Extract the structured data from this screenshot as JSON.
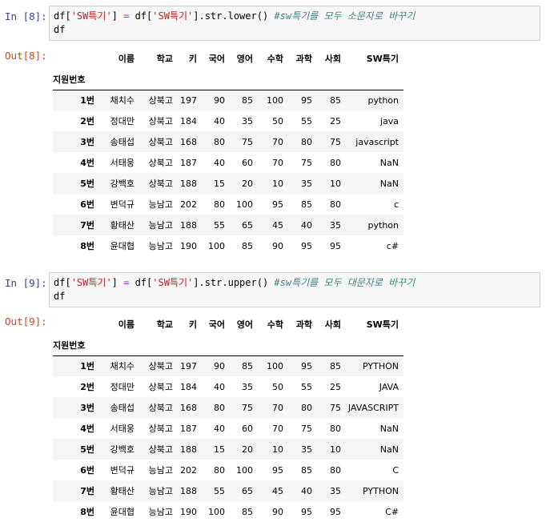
{
  "cells": [
    {
      "in_prompt": "In [8]:",
      "out_prompt": "Out[8]:",
      "code_line1": {
        "a": "df[",
        "s1": "'SW특기'",
        "b": "] ",
        "eq": "=",
        "c": " df[",
        "s2": "'SW특기'",
        "d": "].str.lower() ",
        "comment": "#sw특기를 모두 소문자로 바꾸기"
      },
      "code_line2": "df",
      "table": {
        "columns": [
          "이름",
          "학교",
          "키",
          "국어",
          "영어",
          "수학",
          "과학",
          "사회",
          "SW특기"
        ],
        "index_name": "지원번호",
        "rows": [
          {
            "idx": "1번",
            "vals": [
              "채치수",
              "상북고",
              "197",
              "90",
              "85",
              "100",
              "95",
              "85",
              "python"
            ]
          },
          {
            "idx": "2번",
            "vals": [
              "정대만",
              "상북고",
              "184",
              "40",
              "35",
              "50",
              "55",
              "25",
              "java"
            ]
          },
          {
            "idx": "3번",
            "vals": [
              "송태섭",
              "상북고",
              "168",
              "80",
              "75",
              "70",
              "80",
              "75",
              "javascript"
            ]
          },
          {
            "idx": "4번",
            "vals": [
              "서태웅",
              "상북고",
              "187",
              "40",
              "60",
              "70",
              "75",
              "80",
              "NaN"
            ]
          },
          {
            "idx": "5번",
            "vals": [
              "강백호",
              "상북고",
              "188",
              "15",
              "20",
              "10",
              "35",
              "10",
              "NaN"
            ]
          },
          {
            "idx": "6번",
            "vals": [
              "변덕규",
              "능남고",
              "202",
              "80",
              "100",
              "95",
              "85",
              "80",
              "c"
            ]
          },
          {
            "idx": "7번",
            "vals": [
              "황태산",
              "능남고",
              "188",
              "55",
              "65",
              "45",
              "40",
              "35",
              "python"
            ]
          },
          {
            "idx": "8번",
            "vals": [
              "윤대협",
              "능남고",
              "190",
              "100",
              "85",
              "90",
              "95",
              "95",
              "c#"
            ]
          }
        ]
      }
    },
    {
      "in_prompt": "In [9]:",
      "out_prompt": "Out[9]:",
      "code_line1": {
        "a": "df[",
        "s1": "'SW특기'",
        "b": "] ",
        "eq": "=",
        "c": " df[",
        "s2": "'SW특기'",
        "d": "].str.upper() ",
        "comment": "#sw특기를 모두 대문자로 바꾸기"
      },
      "code_line2": "df",
      "table": {
        "columns": [
          "이름",
          "학교",
          "키",
          "국어",
          "영어",
          "수학",
          "과학",
          "사회",
          "SW특기"
        ],
        "index_name": "지원번호",
        "rows": [
          {
            "idx": "1번",
            "vals": [
              "채치수",
              "상북고",
              "197",
              "90",
              "85",
              "100",
              "95",
              "85",
              "PYTHON"
            ]
          },
          {
            "idx": "2번",
            "vals": [
              "정대만",
              "상북고",
              "184",
              "40",
              "35",
              "50",
              "55",
              "25",
              "JAVA"
            ]
          },
          {
            "idx": "3번",
            "vals": [
              "송태섭",
              "상북고",
              "168",
              "80",
              "75",
              "70",
              "80",
              "75",
              "JAVASCRIPT"
            ]
          },
          {
            "idx": "4번",
            "vals": [
              "서태웅",
              "상북고",
              "187",
              "40",
              "60",
              "70",
              "75",
              "80",
              "NaN"
            ]
          },
          {
            "idx": "5번",
            "vals": [
              "강백호",
              "상북고",
              "188",
              "15",
              "20",
              "10",
              "35",
              "10",
              "NaN"
            ]
          },
          {
            "idx": "6번",
            "vals": [
              "변덕규",
              "능남고",
              "202",
              "80",
              "100",
              "95",
              "85",
              "80",
              "C"
            ]
          },
          {
            "idx": "7번",
            "vals": [
              "황태산",
              "능남고",
              "188",
              "55",
              "65",
              "45",
              "40",
              "35",
              "PYTHON"
            ]
          },
          {
            "idx": "8번",
            "vals": [
              "윤대협",
              "능남고",
              "190",
              "100",
              "85",
              "90",
              "95",
              "95",
              "C#"
            ]
          }
        ]
      }
    }
  ]
}
